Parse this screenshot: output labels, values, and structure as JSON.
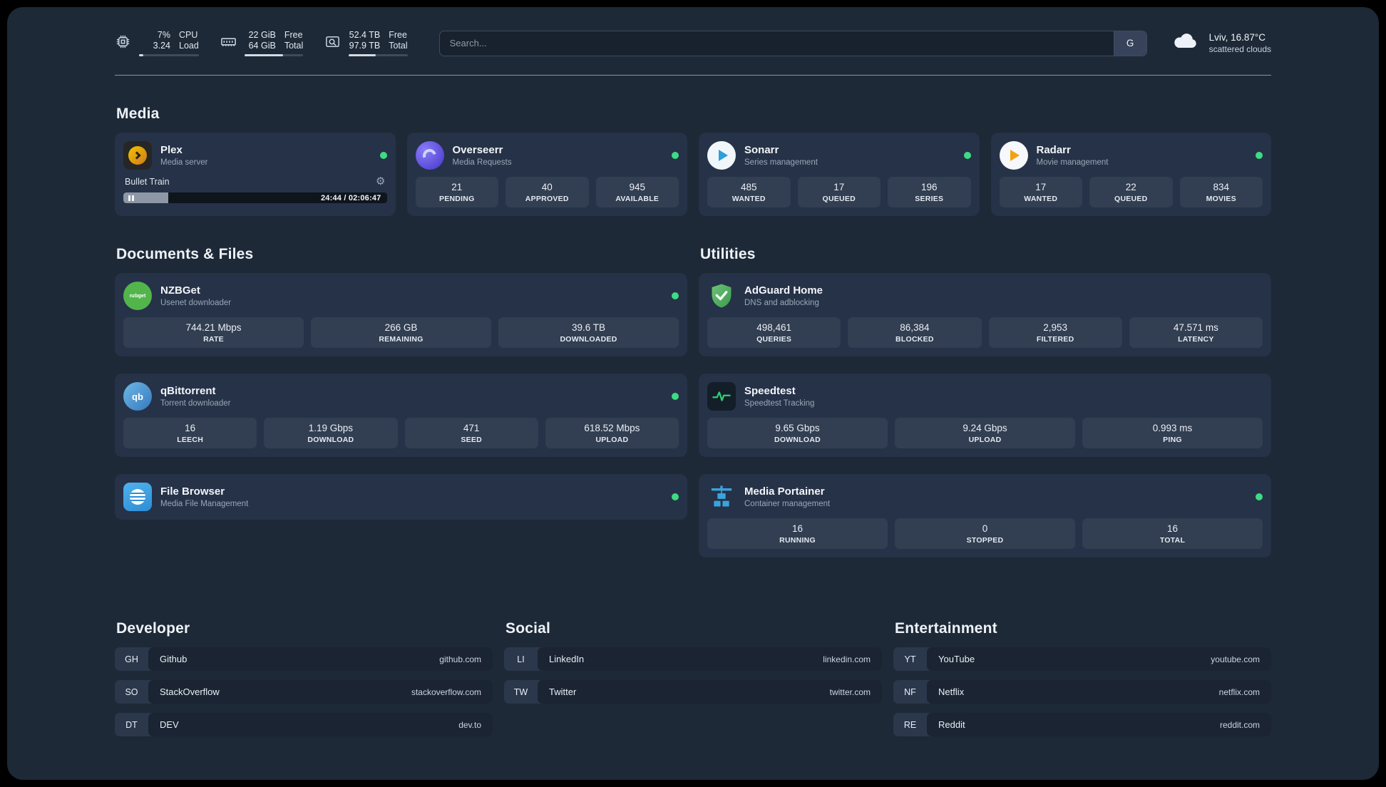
{
  "colors": {
    "status_online": "#3ddc84",
    "page_background": "#1d2937",
    "card_background": "#263247"
  },
  "topbar": {
    "cpu": {
      "v1": "7%",
      "l1": "CPU",
      "v2": "3.24",
      "l2": "Load",
      "bar": "7%"
    },
    "ram": {
      "v1": "22 GiB",
      "l1": "Free",
      "v2": "64 GiB",
      "l2": "Total",
      "bar": "66%"
    },
    "disk": {
      "v1": "52.4 TB",
      "l1": "Free",
      "v2": "97.9 TB",
      "l2": "Total",
      "bar": "46%"
    },
    "search": {
      "placeholder": "Search...",
      "button_label": "G"
    },
    "weather": {
      "line1": "Lviv, 16.87°C",
      "line2": "scattered clouds"
    }
  },
  "media": {
    "heading": "Media",
    "plex": {
      "title": "Plex",
      "subtitle": "Media server",
      "now_playing": "Bullet Train",
      "progress": "17%",
      "time": "24:44 / 02:06:47"
    },
    "cards": [
      {
        "title": "Overseerr",
        "subtitle": "Media Requests",
        "stats": [
          {
            "value": "21",
            "label": "PENDING"
          },
          {
            "value": "40",
            "label": "APPROVED"
          },
          {
            "value": "945",
            "label": "AVAILABLE"
          }
        ]
      },
      {
        "title": "Sonarr",
        "subtitle": "Series management",
        "stats": [
          {
            "value": "485",
            "label": "WANTED"
          },
          {
            "value": "17",
            "label": "QUEUED"
          },
          {
            "value": "196",
            "label": "SERIES"
          }
        ]
      },
      {
        "title": "Radarr",
        "subtitle": "Movie management",
        "stats": [
          {
            "value": "17",
            "label": "WANTED"
          },
          {
            "value": "22",
            "label": "QUEUED"
          },
          {
            "value": "834",
            "label": "MOVIES"
          }
        ]
      }
    ]
  },
  "documents": {
    "heading": "Documents & Files",
    "cards": [
      {
        "title": "NZBGet",
        "subtitle": "Usenet downloader",
        "stats": [
          {
            "value": "744.21 Mbps",
            "label": "RATE"
          },
          {
            "value": "266 GB",
            "label": "REMAINING"
          },
          {
            "value": "39.6 TB",
            "label": "DOWNLOADED"
          }
        ]
      },
      {
        "title": "qBittorrent",
        "subtitle": "Torrent downloader",
        "stats": [
          {
            "value": "16",
            "label": "LEECH"
          },
          {
            "value": "1.19 Gbps",
            "label": "DOWNLOAD"
          },
          {
            "value": "471",
            "label": "SEED"
          },
          {
            "value": "618.52 Mbps",
            "label": "UPLOAD"
          }
        ]
      },
      {
        "title": "File Browser",
        "subtitle": "Media File Management",
        "stats": []
      }
    ]
  },
  "utilities": {
    "heading": "Utilities",
    "cards": [
      {
        "title": "AdGuard Home",
        "subtitle": "DNS and adblocking",
        "stats": [
          {
            "value": "498,461",
            "label": "QUERIES"
          },
          {
            "value": "86,384",
            "label": "BLOCKED"
          },
          {
            "value": "2,953",
            "label": "FILTERED"
          },
          {
            "value": "47.571 ms",
            "label": "LATENCY"
          }
        ]
      },
      {
        "title": "Speedtest",
        "subtitle": "Speedtest Tracking",
        "stats": [
          {
            "value": "9.65 Gbps",
            "label": "DOWNLOAD"
          },
          {
            "value": "9.24 Gbps",
            "label": "UPLOAD"
          },
          {
            "value": "0.993 ms",
            "label": "PING"
          }
        ]
      },
      {
        "title": "Media Portainer",
        "subtitle": "Container management",
        "stats": [
          {
            "value": "16",
            "label": "RUNNING"
          },
          {
            "value": "0",
            "label": "STOPPED"
          },
          {
            "value": "16",
            "label": "TOTAL"
          }
        ]
      }
    ]
  },
  "bookmarks": {
    "developer": {
      "heading": "Developer",
      "items": [
        {
          "abbr": "GH",
          "name": "Github",
          "url": "github.com"
        },
        {
          "abbr": "SO",
          "name": "StackOverflow",
          "url": "stackoverflow.com"
        },
        {
          "abbr": "DT",
          "name": "DEV",
          "url": "dev.to"
        }
      ]
    },
    "social": {
      "heading": "Social",
      "items": [
        {
          "abbr": "LI",
          "name": "LinkedIn",
          "url": "linkedin.com"
        },
        {
          "abbr": "TW",
          "name": "Twitter",
          "url": "twitter.com"
        }
      ]
    },
    "entertainment": {
      "heading": "Entertainment",
      "items": [
        {
          "abbr": "YT",
          "name": "YouTube",
          "url": "youtube.com"
        },
        {
          "abbr": "NF",
          "name": "Netflix",
          "url": "netflix.com"
        },
        {
          "abbr": "RE",
          "name": "Reddit",
          "url": "reddit.com"
        }
      ]
    }
  }
}
